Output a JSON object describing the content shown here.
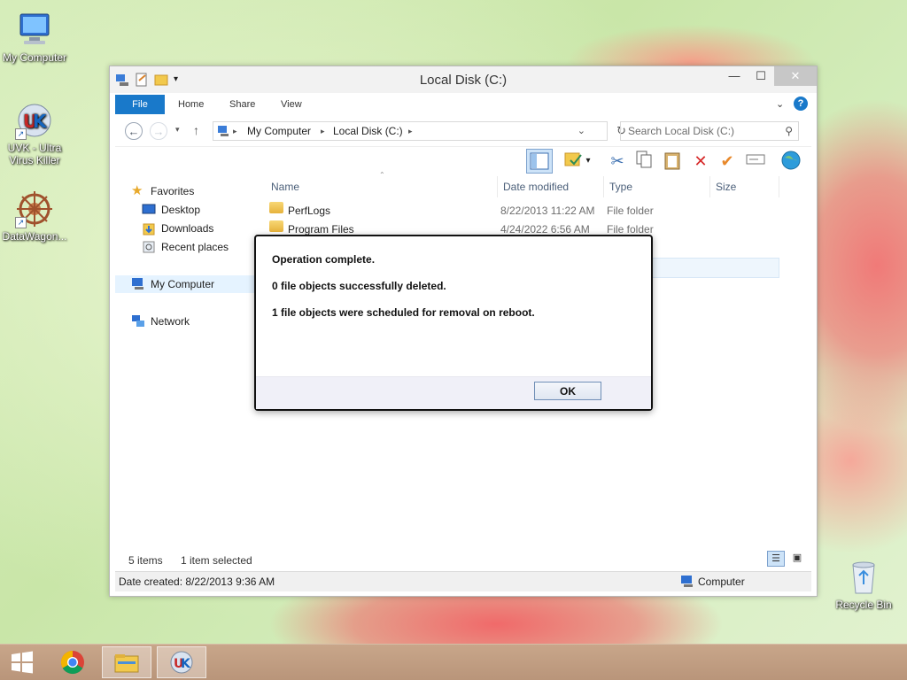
{
  "desktop": {
    "icons": [
      {
        "label": "My Computer",
        "icon": "computer-icon"
      },
      {
        "label": "UVK - Ultra Virus Killer",
        "icon": "uvk-icon"
      },
      {
        "label": "DataWagon...",
        "icon": "datawagon-icon"
      },
      {
        "label": "Recycle Bin",
        "icon": "recycle-bin-icon"
      }
    ]
  },
  "window": {
    "title": "Local Disk (C:)",
    "tabs": {
      "file": "File",
      "home": "Home",
      "share": "Share",
      "view": "View"
    },
    "breadcrumb": {
      "root": "My Computer",
      "current": "Local Disk (C:)"
    },
    "search_placeholder": "Search Local Disk (C:)",
    "columns": {
      "name": "Name",
      "date": "Date modified",
      "type": "Type",
      "size": "Size"
    },
    "files": [
      {
        "name": "PerfLogs",
        "date": "8/22/2013 11:22 AM",
        "type": "File folder"
      },
      {
        "name": "Program Files",
        "date": "4/24/2022 6:56 AM",
        "type": "File folder"
      }
    ],
    "nav": {
      "favorites": "Favorites",
      "desktop": "Desktop",
      "downloads": "Downloads",
      "recent": "Recent places",
      "computer": "My Computer",
      "network": "Network"
    },
    "status": {
      "items": "5 items",
      "selected": "1 item selected"
    },
    "info": {
      "date_created": "Date created: 8/22/2013 9:36 AM",
      "location": "Computer"
    }
  },
  "dialog": {
    "line1": "Operation complete.",
    "line2": "0 file objects successfully deleted.",
    "line3": "1 file objects were scheduled for removal on reboot.",
    "ok_label": "OK"
  },
  "colors": {
    "accent": "#1979ca",
    "selected_item": "#cce8ff"
  }
}
